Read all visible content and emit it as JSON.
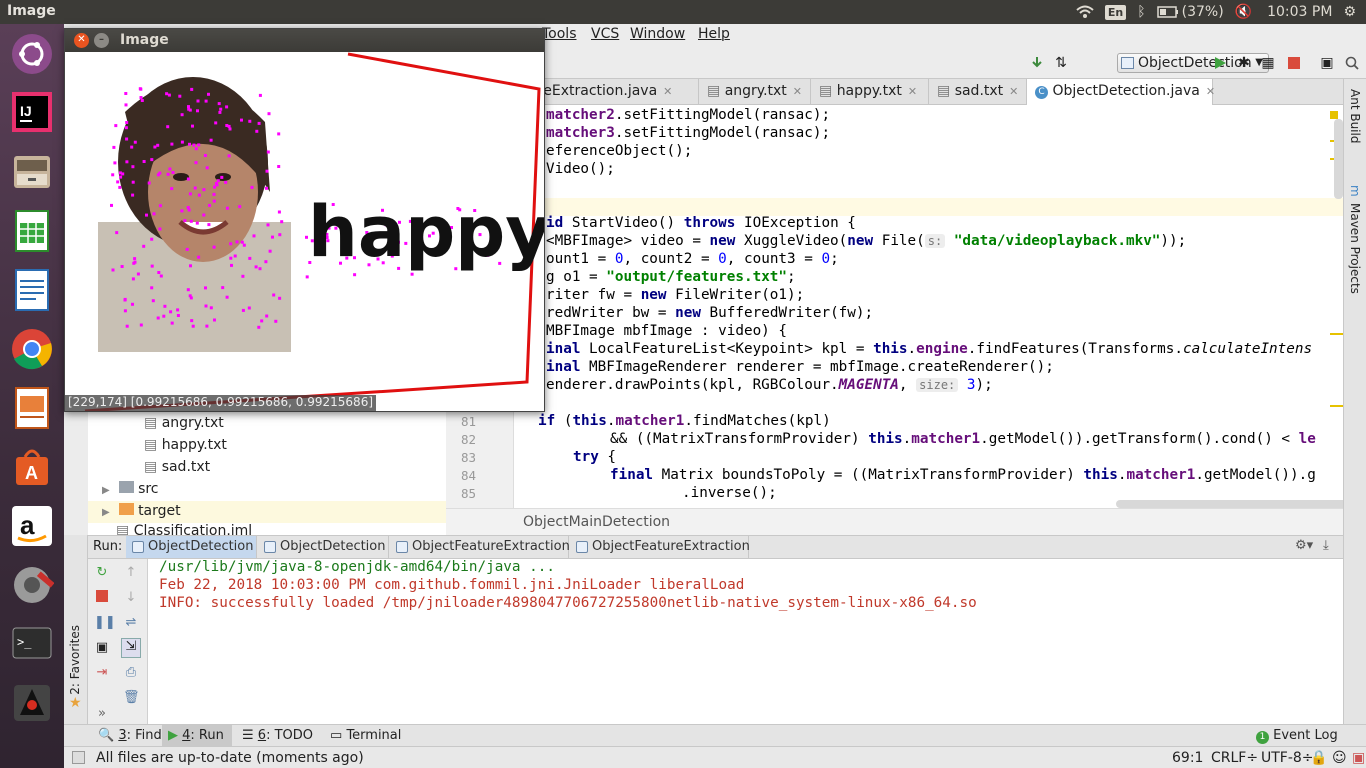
{
  "topbar": {
    "app_name": "Image",
    "lang": "En",
    "battery": "(37%)",
    "time": "10:03 PM"
  },
  "menu": {
    "tools": "Tools",
    "vcs": "VCS",
    "window": "Window",
    "help": "Help"
  },
  "toolbar": {
    "run_config": "ObjectDetection"
  },
  "editor_tabs": [
    {
      "label": "FeatureExtraction.java"
    },
    {
      "label": "angry.txt"
    },
    {
      "label": "happy.txt"
    },
    {
      "label": "sad.txt"
    },
    {
      "label": "ObjectDetection.java"
    }
  ],
  "right_panel": {
    "ant_build": "Ant Build",
    "maven": "Maven Projects"
  },
  "code": {
    "l1a": "matcher2",
    "l1b": ".setFittingModel(ransac);",
    "l2a": "matcher3",
    "l2b": ".setFittingModel(ransac);",
    "l3": "eferenceObject();",
    "l4": "Video();",
    "l6a": "id",
    "l6b": " StartVideo() ",
    "l6c": "throws",
    "l6d": " IOException {",
    "l7a": "<MBFImage> video = ",
    "l7b": "new",
    "l7c": " XuggleVideo(",
    "l7d": "new",
    "l7e": " File(",
    "l7hint": "s:",
    "l7f": "\"data/videoplayback.mkv\"",
    "l7g": "));",
    "l8a": "ount1 = ",
    "l8b": "0",
    "l8c": ", count2 = ",
    "l8d": "0",
    "l8e": ", count3 = ",
    "l8f": "0",
    "l8g": ";",
    "l9a": "g o1 = ",
    "l9b": "\"output/features.txt\"",
    "l9c": ";",
    "l10a": "riter fw = ",
    "l10b": "new",
    "l10c": " FileWriter(o1);",
    "l11a": "redWriter bw = ",
    "l11b": "new",
    "l11c": " BufferedWriter(fw);",
    "l12": "MBFImage mbfImage : video) {",
    "l13a": "inal",
    "l13b": " LocalFeatureList<Keypoint> kpl = ",
    "l13c": "this",
    "l13d": ".",
    "l13e": "engine",
    "l13f": ".findFeatures(Transforms.",
    "l13g": "calculateIntens",
    "l14a": "inal",
    "l14b": " MBFImageRenderer renderer = mbfImage.createRenderer();",
    "l15a": "enderer.drawPoints(kpl, RGBColour.",
    "l15b": "MAGENTA",
    "l15c": ", ",
    "l15hint": "size:",
    "l15d": " 3",
    "l15e": ");",
    "l16a": "if",
    "l16b": " (",
    "l16c": "this",
    "l16d": ".",
    "l16e": "matcher1",
    "l16f": ".findMatches(kpl)",
    "l17a": "&& ((MatrixTransformProvider) ",
    "l17b": "this",
    "l17c": ".",
    "l17d": "matcher1",
    "l17e": ".getModel()).getTransform().cond() < ",
    "l17f": "le",
    "l18a": "try",
    "l18b": " {",
    "l19a": "final",
    "l19b": " Matrix boundsToPoly = ((MatrixTransformProvider) ",
    "l19c": "this",
    "l19d": ".",
    "l19e": "matcher1",
    "l19f": ".getModel()).g",
    "l20": ".inverse();"
  },
  "line_numbers": [
    "81",
    "82",
    "83",
    "84",
    "85"
  ],
  "breadcrumb": "ObjectMainDetection",
  "project_tree": {
    "angry": "angry.txt",
    "happy": "happy.txt",
    "sad": "sad.txt",
    "src": "src",
    "target": "target",
    "iml": "Classification.iml"
  },
  "run_panel": {
    "label": "Run:",
    "tabs": [
      "ObjectDetection",
      "ObjectDetection",
      "ObjectFeatureExtraction",
      "ObjectFeatureExtraction"
    ]
  },
  "console": {
    "line1": "/usr/lib/jvm/java-8-openjdk-amd64/bin/java ...",
    "line2": "Feb 22, 2018 10:03:00 PM com.github.fommil.jni.JniLoader liberalLoad",
    "line3": "INFO: successfully loaded /tmp/jniloader4898047706727255800netlib-native_system-linux-x86_64.so"
  },
  "favorites": "2: Favorites",
  "tool_windows": {
    "find_num": "3",
    "find": ": Find",
    "run_num": "4",
    "run": ": Run",
    "todo_num": "6",
    "todo": ": TODO",
    "terminal": "Terminal",
    "event_log": "Event Log",
    "event_count": "1"
  },
  "status": {
    "message": "All files are up-to-date (moments ago)",
    "position": "69:1",
    "line_sep": "CRLF÷",
    "encoding": "UTF-8÷"
  },
  "image_window": {
    "title": "Image",
    "text": "happy",
    "pixel_info": "[229,174] [0.99215686, 0.99215686, 0.99215686]"
  }
}
